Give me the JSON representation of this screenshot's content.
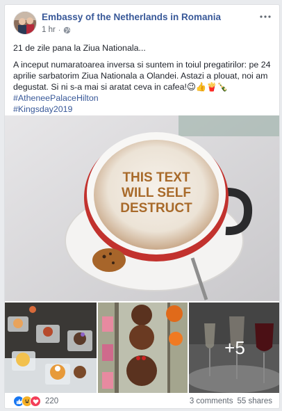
{
  "post": {
    "page_name": "Embassy of the Netherlands in Romania",
    "time": "1 hr",
    "separator": "·",
    "privacy_icon": "globe-icon",
    "more_icon": "ellipsis-icon",
    "text_line1": "21 de zile pana la Ziua Nationala...",
    "text_body": "A inceput numaratoarea inversa si suntem in toiul pregatirilor: pe 24 aprilie sarbatorim Ziua Nationala a Olandei. Astazi a plouat, noi am degustat. Si ni s-a mai si aratat ceva in cafea!😉👍🍟🍾",
    "hashtags": [
      "#AtheneePalaceHilton",
      "#Kingsday2019"
    ]
  },
  "photos": {
    "main_latte_art_text": [
      "THIS TEXT",
      "WILL SELF",
      "DESTRUCT"
    ],
    "more_count": "+5"
  },
  "footer": {
    "reaction_icons": [
      "like-icon",
      "haha-icon",
      "love-icon"
    ],
    "reaction_count": "220",
    "comments": "3 comments",
    "shares": "55 shares"
  },
  "colors": {
    "link": "#385898",
    "like": "#1877f2",
    "love": "#f33e58",
    "haha": "#f7b125"
  }
}
